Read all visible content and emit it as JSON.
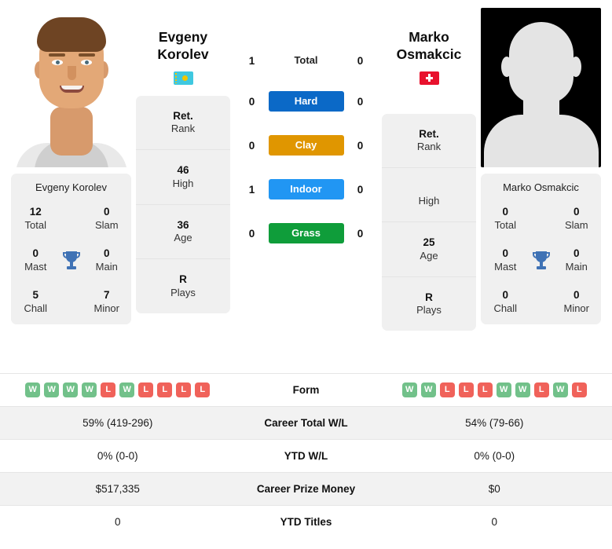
{
  "players": {
    "left": {
      "name": "Evgeny Korolev",
      "first_name": "Evgeny",
      "last_name": "Korolev",
      "flag": "kazakhstan-flag",
      "photo": "player-photo",
      "rank_value": "Ret.",
      "rank_label": "Rank",
      "high_value": "46",
      "high_label": "High",
      "age_value": "36",
      "age_label": "Age",
      "plays_value": "R",
      "plays_label": "Plays",
      "titles": {
        "total_value": "12",
        "total_label": "Total",
        "slam_value": "0",
        "slam_label": "Slam",
        "mast_value": "0",
        "mast_label": "Mast",
        "main_value": "0",
        "main_label": "Main",
        "chall_value": "5",
        "chall_label": "Chall",
        "minor_value": "7",
        "minor_label": "Minor"
      },
      "form": [
        "W",
        "W",
        "W",
        "W",
        "L",
        "W",
        "L",
        "L",
        "L",
        "L"
      ],
      "career_total_wl": "59% (419-296)",
      "ytd_wl": "0% (0-0)",
      "career_prize_money": "$517,335",
      "ytd_titles": "0"
    },
    "right": {
      "name": "Marko Osmakcic",
      "first_name": "Marko",
      "last_name": "Osmakcic",
      "flag": "switzerland-flag",
      "photo": "placeholder-avatar",
      "rank_value": "Ret.",
      "rank_label": "Rank",
      "high_value": "",
      "high_label": "High",
      "age_value": "25",
      "age_label": "Age",
      "plays_value": "R",
      "plays_label": "Plays",
      "titles": {
        "total_value": "0",
        "total_label": "Total",
        "slam_value": "0",
        "slam_label": "Slam",
        "mast_value": "0",
        "mast_label": "Mast",
        "main_value": "0",
        "main_label": "Main",
        "chall_value": "0",
        "chall_label": "Chall",
        "minor_value": "0",
        "minor_label": "Minor"
      },
      "form": [
        "W",
        "W",
        "L",
        "L",
        "L",
        "W",
        "W",
        "L",
        "W",
        "L"
      ],
      "career_total_wl": "54% (79-66)",
      "ytd_wl": "0% (0-0)",
      "career_prize_money": "$0",
      "ytd_titles": "0"
    }
  },
  "head_to_head": {
    "rows": [
      {
        "label": "Total",
        "left": "1",
        "right": "0",
        "style": "plain",
        "color": ""
      },
      {
        "label": "Hard",
        "left": "0",
        "right": "0",
        "style": "pill",
        "color": "#0b69c7"
      },
      {
        "label": "Clay",
        "left": "0",
        "right": "0",
        "style": "pill",
        "color": "#e09600"
      },
      {
        "label": "Indoor",
        "left": "1",
        "right": "0",
        "style": "pill",
        "color": "#2196f3"
      },
      {
        "label": "Grass",
        "left": "0",
        "right": "0",
        "style": "pill",
        "color": "#0f9d3a"
      }
    ]
  },
  "stats_table": {
    "rows": [
      {
        "label": "Form",
        "type": "form"
      },
      {
        "label": "Career Total W/L",
        "type": "text",
        "key": "career_total_wl"
      },
      {
        "label": "YTD W/L",
        "type": "text",
        "key": "ytd_wl"
      },
      {
        "label": "Career Prize Money",
        "type": "text",
        "key": "career_prize_money"
      },
      {
        "label": "YTD Titles",
        "type": "text",
        "key": "ytd_titles"
      }
    ]
  },
  "colors": {
    "hard": "#0b69c7",
    "clay": "#e09600",
    "indoor": "#2196f3",
    "grass": "#0f9d3a",
    "win_badge": "#72c18a",
    "loss_badge": "#f0625a",
    "card_bg": "#f0f0f0",
    "row_alt_bg": "#f2f2f2"
  }
}
